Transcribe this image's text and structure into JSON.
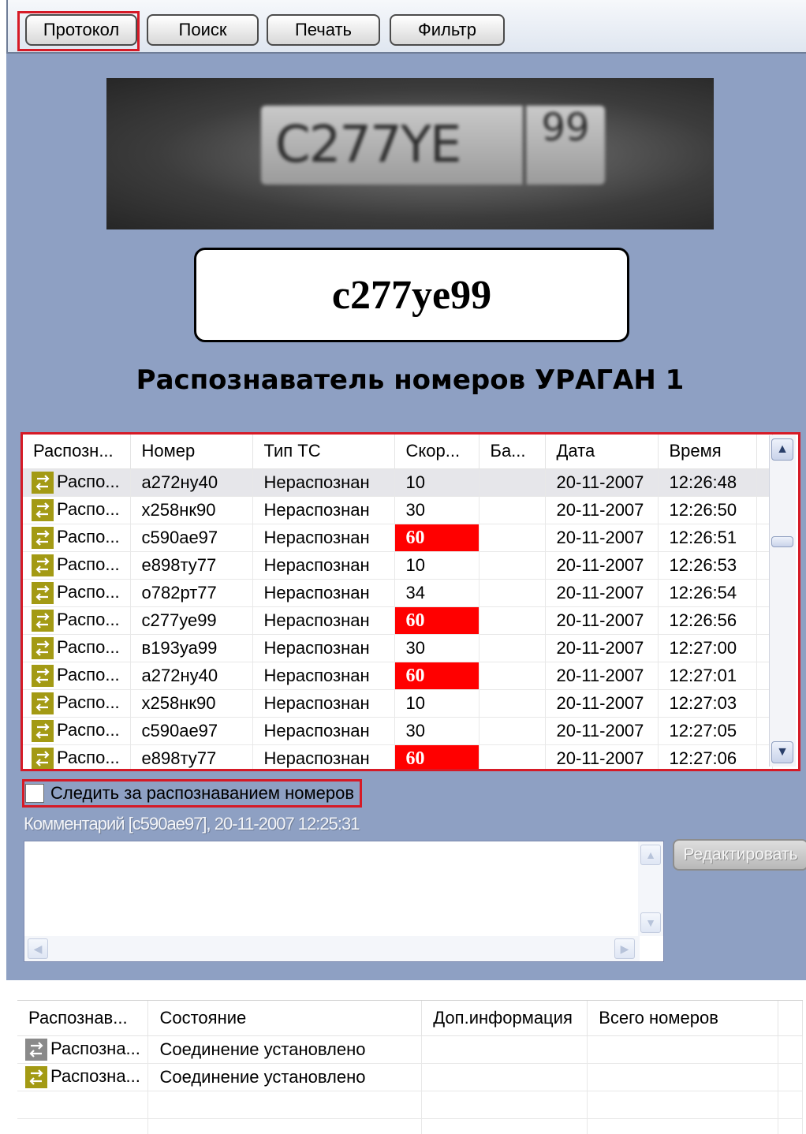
{
  "toolbar": {
    "buttons": [
      "Протокол",
      "Поиск",
      "Печать",
      "Фильтр"
    ],
    "highlight_color": "#d61a26"
  },
  "plate_image": {
    "main_text": "C277YE",
    "region_text": "99"
  },
  "recognized_number": "c277ye99",
  "recognizer_title": "Распознаватель номеров УРАГАН 1",
  "table": {
    "headers": [
      "Распозн...",
      "Номер",
      "Тип ТС",
      "Скор...",
      "Ба...",
      "Дата",
      "Время"
    ],
    "rows": [
      {
        "rec": "Распо...",
        "num": "а272ну40",
        "type": "Нераспознан",
        "speed": "10",
        "ba": "",
        "date": "20-11-2007",
        "time": "12:26:48",
        "alert": false,
        "selected": true
      },
      {
        "rec": "Распо...",
        "num": "х258нк90",
        "type": "Нераспознан",
        "speed": "30",
        "ba": "",
        "date": "20-11-2007",
        "time": "12:26:50",
        "alert": false,
        "selected": false
      },
      {
        "rec": "Распо...",
        "num": "с590ае97",
        "type": "Нераспознан",
        "speed": "60",
        "ba": "",
        "date": "20-11-2007",
        "time": "12:26:51",
        "alert": true,
        "selected": false
      },
      {
        "rec": "Распо...",
        "num": "е898ту77",
        "type": "Нераспознан",
        "speed": "10",
        "ba": "",
        "date": "20-11-2007",
        "time": "12:26:53",
        "alert": false,
        "selected": false
      },
      {
        "rec": "Распо...",
        "num": "о782рт77",
        "type": "Нераспознан",
        "speed": "34",
        "ba": "",
        "date": "20-11-2007",
        "time": "12:26:54",
        "alert": false,
        "selected": false
      },
      {
        "rec": "Распо...",
        "num": "с277уе99",
        "type": "Нераспознан",
        "speed": "60",
        "ba": "",
        "date": "20-11-2007",
        "time": "12:26:56",
        "alert": true,
        "selected": false
      },
      {
        "rec": "Распо...",
        "num": "в193уа99",
        "type": "Нераспознан",
        "speed": "30",
        "ba": "",
        "date": "20-11-2007",
        "time": "12:27:00",
        "alert": false,
        "selected": false
      },
      {
        "rec": "Распо...",
        "num": "а272ну40",
        "type": "Нераспознан",
        "speed": "60",
        "ba": "",
        "date": "20-11-2007",
        "time": "12:27:01",
        "alert": true,
        "selected": false
      },
      {
        "rec": "Распо...",
        "num": "х258нк90",
        "type": "Нераспознан",
        "speed": "10",
        "ba": "",
        "date": "20-11-2007",
        "time": "12:27:03",
        "alert": false,
        "selected": false
      },
      {
        "rec": "Распо...",
        "num": "с590ае97",
        "type": "Нераспознан",
        "speed": "30",
        "ba": "",
        "date": "20-11-2007",
        "time": "12:27:05",
        "alert": false,
        "selected": false
      },
      {
        "rec": "Распо...",
        "num": "е898ту77",
        "type": "Нераспознан",
        "speed": "60",
        "ba": "",
        "date": "20-11-2007",
        "time": "12:27:06",
        "alert": true,
        "selected": false
      }
    ]
  },
  "follow_checkbox": {
    "label": "Следить за распознаванием номеров",
    "checked": false
  },
  "comment": {
    "label": "Комментарий [с590ае97], 20-11-2007 12:25:31",
    "text": ""
  },
  "edit_button": "Редактировать",
  "status_table": {
    "headers": [
      "Распознав...",
      "Состояние",
      "Доп.информация",
      "Всего номеров"
    ],
    "rows": [
      {
        "rec": "Распозна...",
        "state": "Соединение установлено",
        "info": "",
        "total": "",
        "icon": "gray"
      },
      {
        "rec": "Распозна...",
        "state": "Соединение установлено",
        "info": "",
        "total": "",
        "icon": "olive"
      }
    ]
  },
  "colors": {
    "panel_bg": "#8ea0c3",
    "alert_speed": "#ff0000",
    "icon_olive": "#a39a14",
    "icon_gray": "#8a8a8a"
  },
  "icons": [
    "recognizer-arrows-icon",
    "scroll-up-icon",
    "scroll-down-icon",
    "scroll-left-icon",
    "scroll-right-icon"
  ]
}
